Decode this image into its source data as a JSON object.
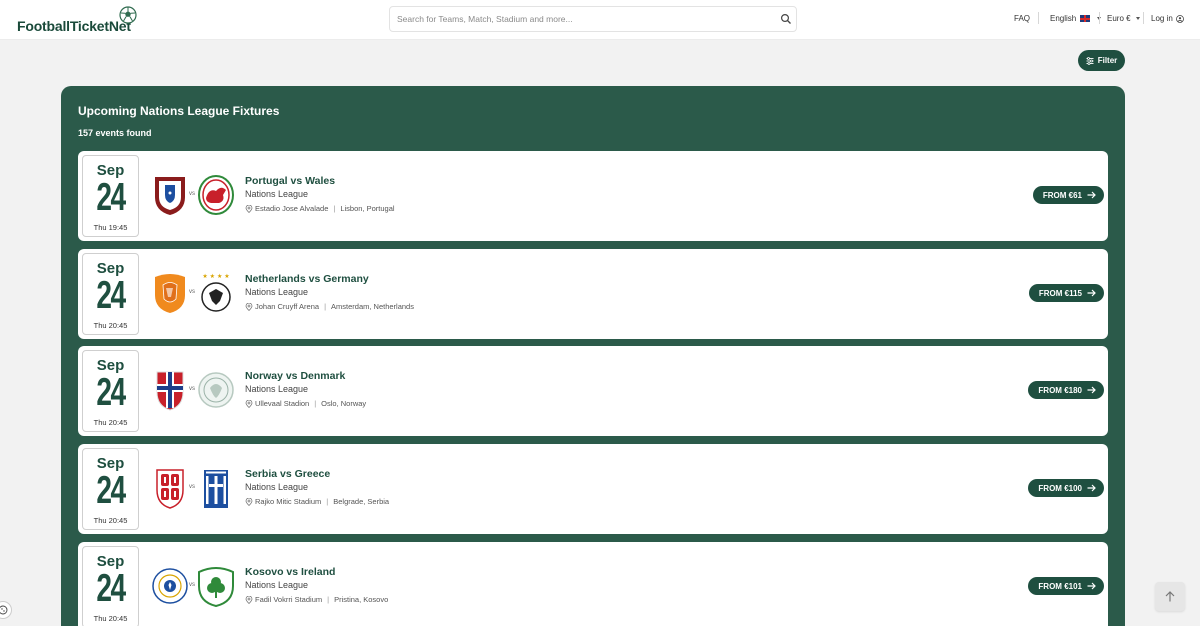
{
  "header": {
    "logo_text": "FootballTicketNet",
    "search_placeholder": "Search for Teams, Match, Stadium and more...",
    "faq": "FAQ",
    "language": "English",
    "currency": "Euro €",
    "login": "Log in"
  },
  "filter_label": "Filter",
  "panel": {
    "title": "Upcoming Nations League Fixtures",
    "count": "157 events found"
  },
  "events": [
    {
      "month": "Sep",
      "day": "24",
      "time": "Thu 19:45",
      "title": "Portugal vs Wales",
      "league": "Nations League",
      "stadium": "Estadio Jose Alvalade",
      "city": "Lisbon, Portugal",
      "price": "FROM €61",
      "home_icon": "portugal-crest-icon",
      "away_icon": "wales-crest-icon"
    },
    {
      "month": "Sep",
      "day": "24",
      "time": "Thu 20:45",
      "title": "Netherlands vs Germany",
      "league": "Nations League",
      "stadium": "Johan Cruyff Arena",
      "city": "Amsterdam, Netherlands",
      "price": "FROM €115",
      "home_icon": "netherlands-crest-icon",
      "away_icon": "germany-crest-icon"
    },
    {
      "month": "Sep",
      "day": "24",
      "time": "Thu 20:45",
      "title": "Norway vs Denmark",
      "league": "Nations League",
      "stadium": "Ullevaal Stadion",
      "city": "Oslo, Norway",
      "price": "FROM €180",
      "home_icon": "norway-crest-icon",
      "away_icon": "denmark-crest-icon"
    },
    {
      "month": "Sep",
      "day": "24",
      "time": "Thu 20:45",
      "title": "Serbia vs Greece",
      "league": "Nations League",
      "stadium": "Rajko Mitic Stadium",
      "city": "Belgrade, Serbia",
      "price": "FROM €100",
      "home_icon": "serbia-crest-icon",
      "away_icon": "greece-crest-icon"
    },
    {
      "month": "Sep",
      "day": "24",
      "time": "Thu 20:45",
      "title": "Kosovo vs Ireland",
      "league": "Nations League",
      "stadium": "Fadil Vokrri Stadium",
      "city": "Pristina, Kosovo",
      "price": "FROM €101",
      "home_icon": "kosovo-crest-icon",
      "away_icon": "ireland-crest-icon"
    }
  ]
}
